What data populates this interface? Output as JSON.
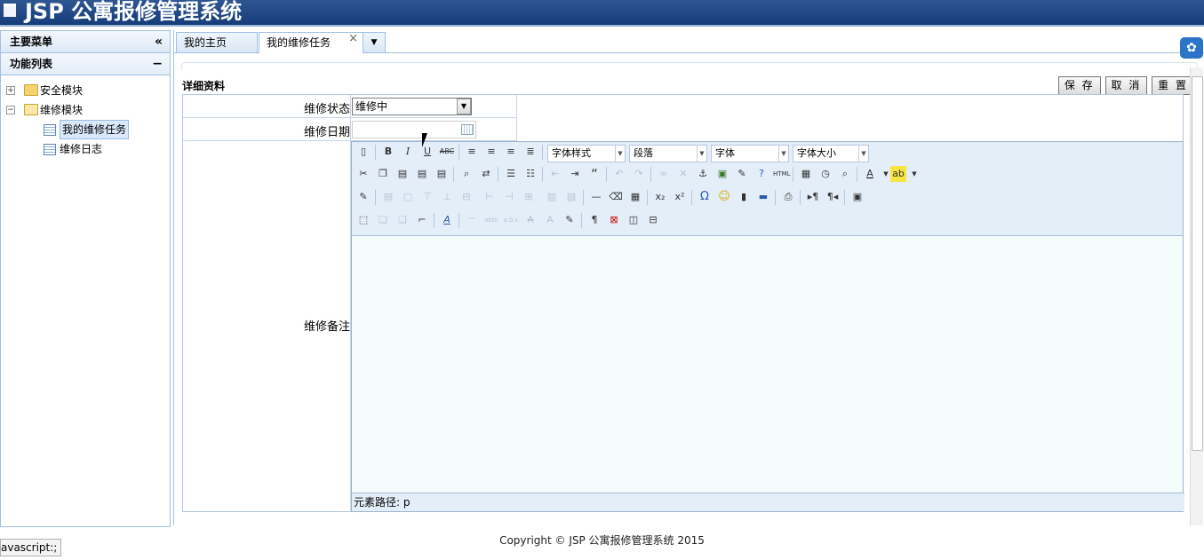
{
  "app": {
    "title": "JSP 公寓报修管理系统"
  },
  "sidebar": {
    "main_menu": "主要菜单",
    "main_menu_tool": "«",
    "function_list": "功能列表",
    "function_list_tool": "−",
    "tree": [
      {
        "label": "安全模块",
        "expanded": false
      },
      {
        "label": "维修模块",
        "expanded": true,
        "children": [
          {
            "label": "我的维修任务",
            "selected": true
          },
          {
            "label": "维修日志"
          }
        ]
      }
    ]
  },
  "tabs": [
    {
      "label": "我的主页"
    },
    {
      "label": "我的维修任务",
      "active": true,
      "closable": true,
      "close_glyph": "×"
    }
  ],
  "tab_menu_glyph": "▼",
  "form": {
    "title": "详细资料",
    "buttons": {
      "save": "保 存",
      "cancel": "取 消",
      "reset": "重 置"
    },
    "status_label": "维修状态",
    "status_value": "维修中",
    "date_label": "维修日期",
    "date_value": "",
    "notes_label": "维修备注"
  },
  "editor": {
    "combos": {
      "style": "字体样式",
      "paragraph": "段落",
      "font": "字体",
      "size": "字体大小"
    },
    "path_label": "元素路径: p"
  },
  "footer": {
    "copyright": "Copyright © JSP 公寓报修管理系统 2015"
  },
  "status_bar": {
    "text": "avascript:;"
  }
}
